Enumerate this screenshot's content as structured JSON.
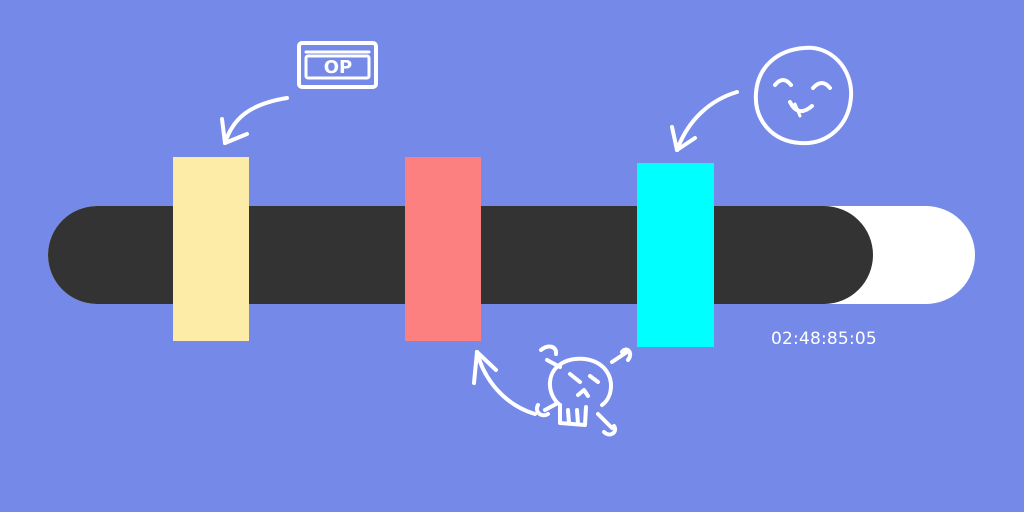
{
  "colors": {
    "background": "#7589e8",
    "track_filled": "#333333",
    "track_empty": "#ffffff",
    "marker_op": "#fdeba8",
    "marker_skull": "#fd8080",
    "marker_smile": "#00ffff",
    "doodle": "#ffffff"
  },
  "progress": {
    "fraction": 0.89
  },
  "markers": [
    {
      "name": "op-marker",
      "color": "#fdeba8",
      "icon": "op-sign-icon"
    },
    {
      "name": "skull-marker",
      "color": "#fd8080",
      "icon": "skull-crossbones-icon"
    },
    {
      "name": "smile-marker",
      "color": "#00ffff",
      "icon": "smiley-face-icon"
    }
  ],
  "timestamp": "02:48:85:05",
  "op_sign": {
    "text": "OP"
  }
}
